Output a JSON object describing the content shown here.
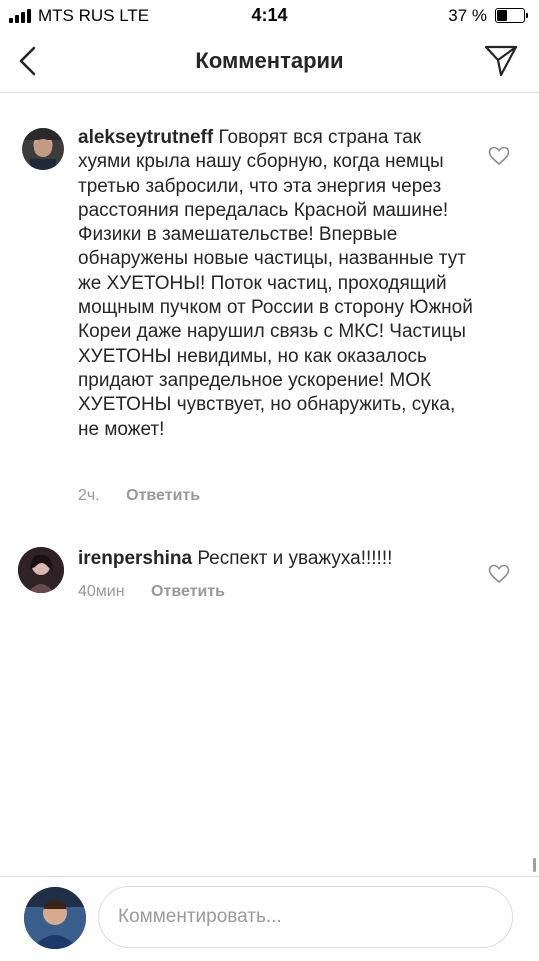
{
  "status_bar": {
    "carrier": "MTS RUS  LTE",
    "time": "4:14",
    "battery": "37 %",
    "battery_level": 0.37
  },
  "header": {
    "title": "Комментарии"
  },
  "comments": [
    {
      "username": "alekseytrutneff",
      "text": "Говорят вся страна так хуями крыла нашу сборную, когда немцы третью забросили, что эта энергия через расстояния передалась Красной машине! Физики в замешательстве! Впервые обнаружены новые частицы, названные тут же ХУЕТОНЫ! Поток частиц, проходящий мощным пучком от России в сторону Южной Кореи даже нарушил связь с МКС! Частицы ХУЕТОНЫ невидимы, но как оказалось придают запредельное ускорение! МОК ХУЕТОНЫ чувствует, но обнаружить, сука, не может!",
      "time": "2ч.",
      "reply_label": "Ответить"
    },
    {
      "username": "irenpershina",
      "text": "Респект и уважуха!!!!!!",
      "time": "40мин",
      "reply_label": "Ответить"
    }
  ],
  "composer": {
    "placeholder": "Комментировать..."
  },
  "icons": {
    "back": "chevron-left-icon",
    "direct": "paper-plane-icon",
    "like": "heart-icon"
  },
  "colors": {
    "text": "#262626",
    "secondary": "#999999",
    "divider": "#dbdbdb"
  }
}
